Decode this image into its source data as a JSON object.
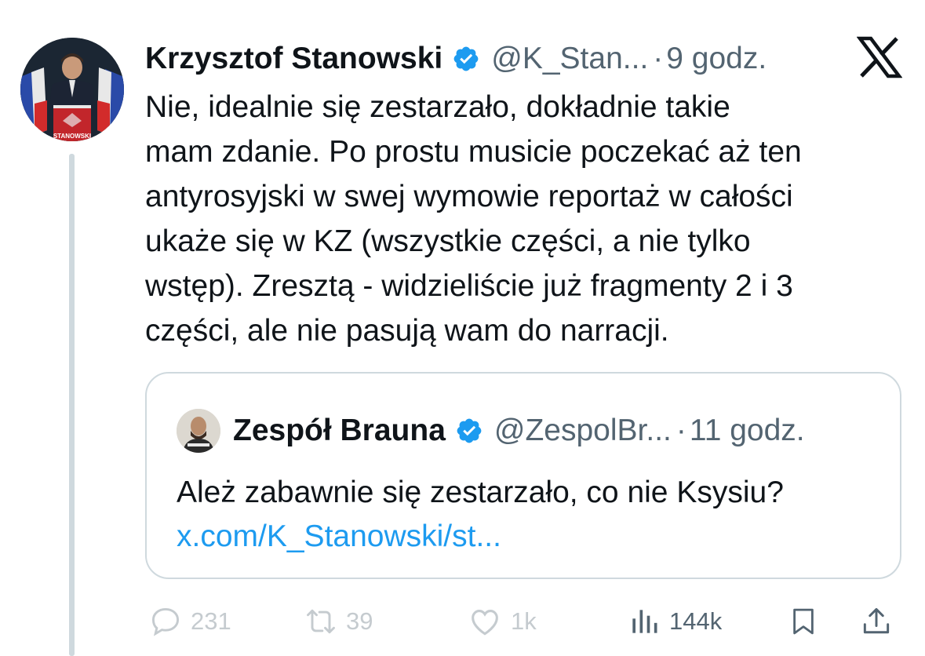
{
  "tweet": {
    "author_name": "Krzysztof Stanowski",
    "handle": "@K_Stan...",
    "separator": "·",
    "time": "9 godz.",
    "avatar_caption": "STANOWSKI",
    "text_lines": [
      "Nie, idealnie się zestarzało, dokładnie takie",
      "mam zdanie. Po prostu musicie poczekać aż ten",
      "antyrosyjski w swej wymowie reportaż w całości",
      "ukaże się w KZ (wszystkie części, a nie tylko",
      "wstęp). Zresztą - widzieliście już fragmenty 2 i 3",
      "części, ale nie pasują wam do narracji."
    ]
  },
  "quote": {
    "author_name": "Zespół Brauna",
    "handle": "@ZespolBr...",
    "separator": "·",
    "time": "11 godz.",
    "text": "Ależ zabawnie się zestarzało, co nie Ksysiu?",
    "link": "x.com/K_Stanowski/st..."
  },
  "actions": {
    "replies": "231",
    "reposts": "39",
    "likes": "1k",
    "views": "144k"
  },
  "icons": [
    "verified-badge-icon",
    "x-logo-icon",
    "reply-icon",
    "repost-icon",
    "like-icon",
    "views-icon",
    "bookmark-icon",
    "share-icon"
  ],
  "colors": {
    "accent": "#1d9bf0",
    "text": "#0f1419",
    "secondary": "#536471",
    "border": "#cfd9de"
  }
}
